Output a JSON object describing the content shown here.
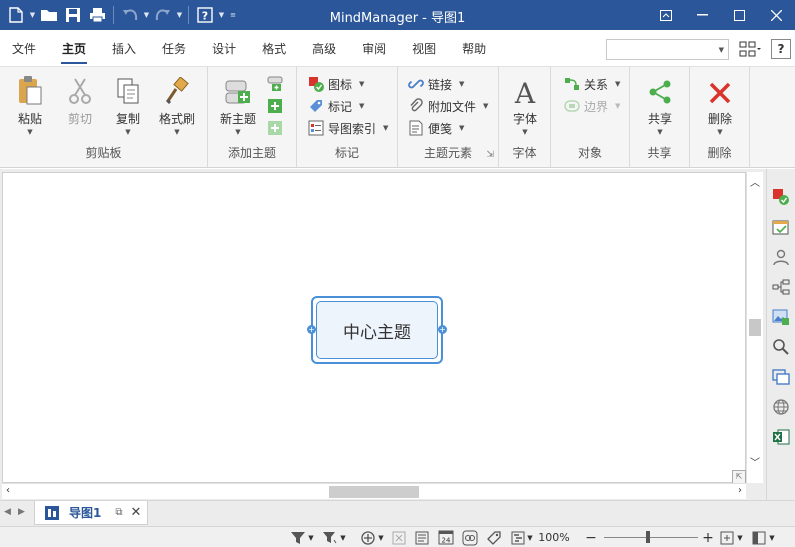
{
  "app": {
    "title": "MindManager - 导图1"
  },
  "menu": {
    "tabs": [
      "文件",
      "主页",
      "插入",
      "任务",
      "设计",
      "格式",
      "高级",
      "审阅",
      "视图",
      "帮助"
    ],
    "active_tab": "主页",
    "help_label": "?"
  },
  "ribbon": {
    "clipboard": {
      "label": "剪贴板",
      "paste": "粘贴",
      "cut": "剪切",
      "copy": "复制",
      "format_painter": "格式刷"
    },
    "add_topic": {
      "label": "添加主题",
      "new_topic": "新主题"
    },
    "markers": {
      "label": "标记",
      "icons": "图标",
      "tags": "标记",
      "map_index": "导图索引"
    },
    "topic_elements": {
      "label": "主题元素",
      "link": "链接",
      "attachment": "附加文件",
      "notes": "便笺"
    },
    "font": {
      "label": "字体",
      "font": "字体"
    },
    "objects": {
      "label": "对象",
      "relationship": "关系",
      "boundary": "边界"
    },
    "share": {
      "label": "共享",
      "share": "共享"
    },
    "delete": {
      "label": "删除",
      "delete": "删除"
    }
  },
  "canvas": {
    "central_topic": "中心主题"
  },
  "document_tabs": [
    {
      "label": "导图1"
    }
  ],
  "status": {
    "zoom": "100%"
  },
  "colors": {
    "title_bar": "#2b579a",
    "topic_border": "#4a90d9",
    "topic_fill": "#eef4fc"
  }
}
